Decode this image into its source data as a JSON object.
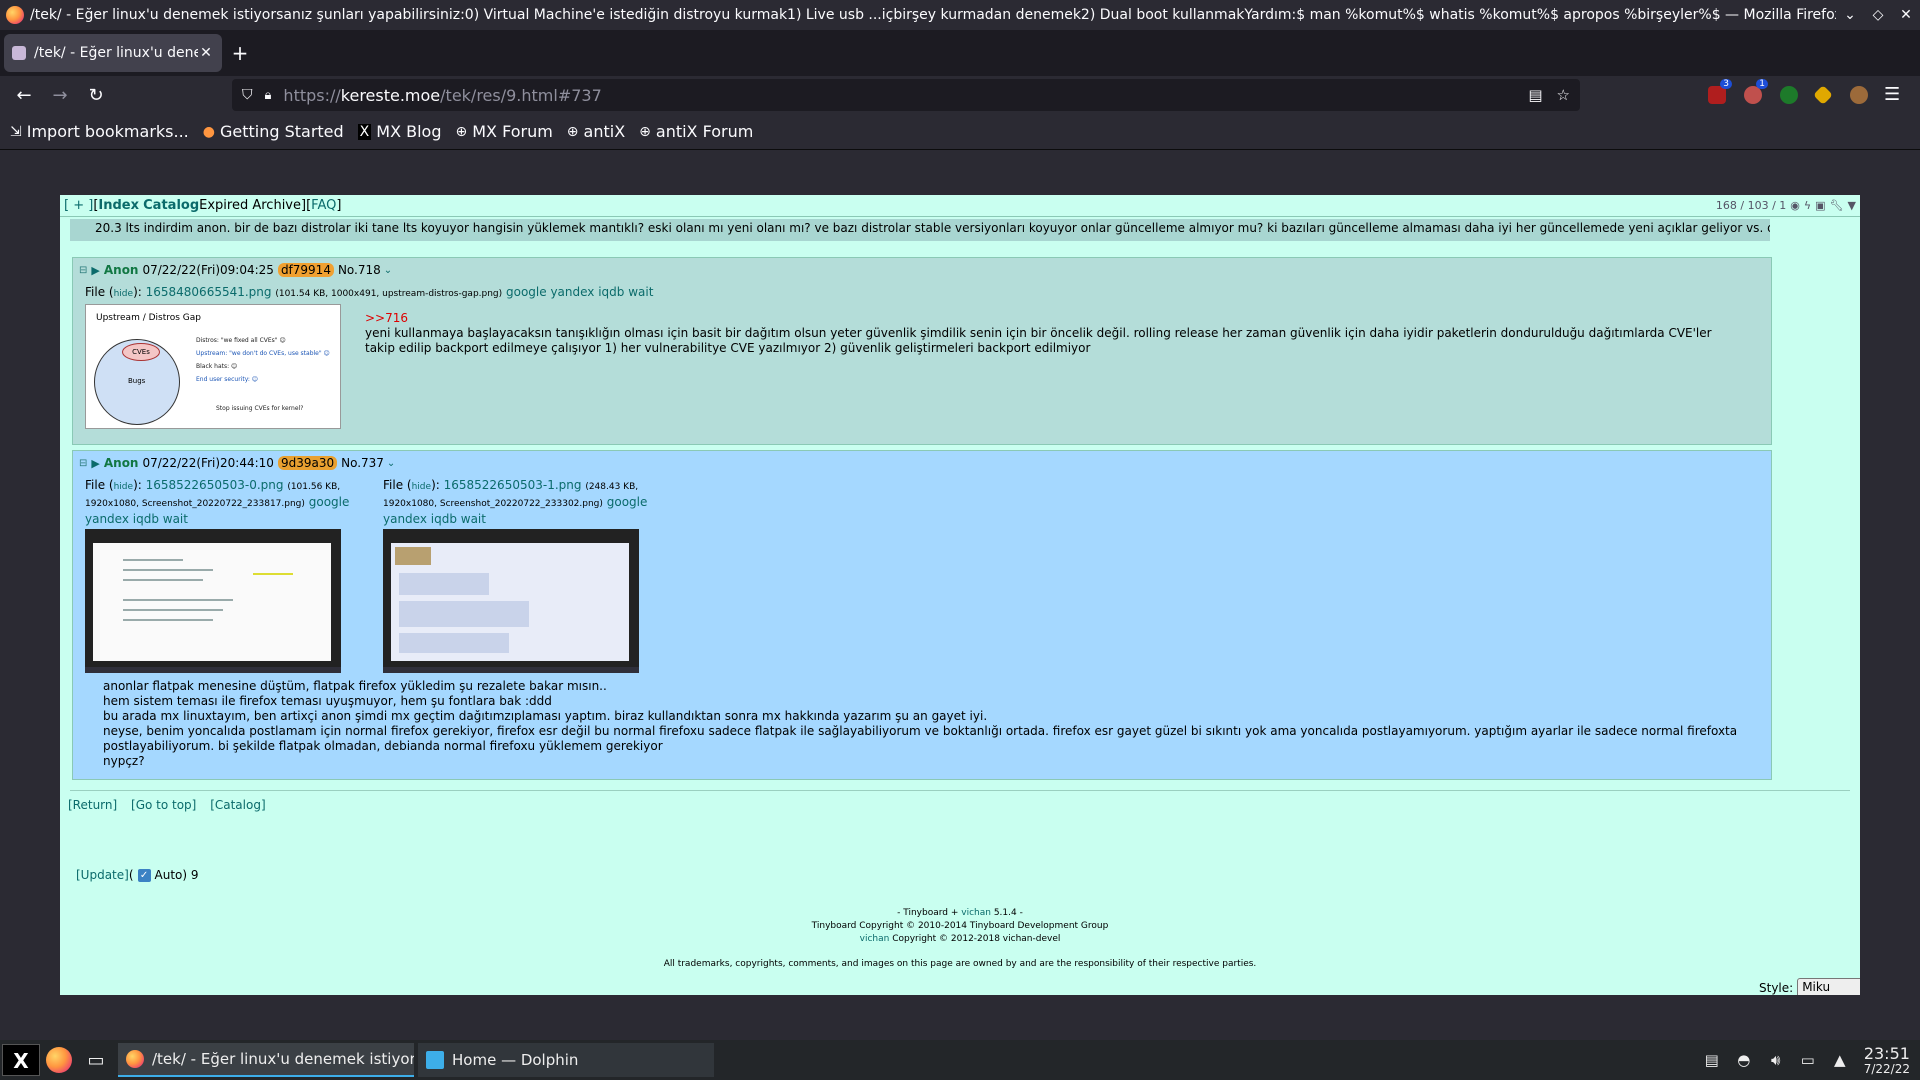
{
  "window": {
    "title": "/tek/ - Eğer linux'u denemek istiyorsanız şunları yapabilirsiniz:0) Virtual Machine'e istediğin distroyu kurmak1) Live usb ...içbirşey kurmadan denemek2) Dual boot kullanmakYardım:$ man %komut%$ whatis %komut%$ apropos %birşeyler%$ — Mozilla Firefox"
  },
  "tabs": [
    {
      "label": "/tek/ - Eğer linux'u dene"
    }
  ],
  "urlbar": {
    "prefix": "https://",
    "domain": "kereste.moe",
    "path": "/tek/res/9.html#737"
  },
  "extensions": [
    {
      "name": "ublock-extension",
      "color": "#b01e1e",
      "badge": "3"
    },
    {
      "name": "tampermonkey-extension",
      "color": "#c0504d",
      "badge": "1"
    },
    {
      "name": "green-extension",
      "color": "#1d7a2a",
      "badge": ""
    },
    {
      "name": "yellow-extension",
      "color": "#e0a800",
      "badge": ""
    },
    {
      "name": "brown-extension",
      "color": "#9c6a3a",
      "badge": ""
    }
  ],
  "bookmarks": [
    {
      "label": "Import bookmarks...",
      "icon": "⇲"
    },
    {
      "label": "Getting Started",
      "icon": "●"
    },
    {
      "label": "MX Blog",
      "icon": "X"
    },
    {
      "label": "MX Forum",
      "icon": "⊕"
    },
    {
      "label": "antiX",
      "icon": "⊕"
    },
    {
      "label": "antiX Forum",
      "icon": "⊕"
    }
  ],
  "boardlist": {
    "plus": "[ + ]",
    "open": " [",
    "index": "Index",
    "catalog": "Catalog",
    "expired": " Expired Archive]",
    "faq_open": " [",
    "faq": "FAQ",
    "faq_close": "]",
    "counts": "168 / 103 / 1"
  },
  "prev_post": {
    "text": "20.3 lts indirdim anon. bir de bazı distrolar iki tane lts koyuyor hangisin yüklemek mantıklı? eski olanı mı yeni olanı mı? ve bazı distrolar stable versiyonları koyuyor onlar güncelleme almıyor mu?  ki bazıları güncelleme almaması daha iyi her güncellemede yeni açıklar geliyor vs. diyorlar."
  },
  "posts": {
    "p718": {
      "name": "Anon",
      "date": "07/22/22(Fri)09:04:25",
      "id": "df79914",
      "id_color": "#f0a030",
      "no": "No.718",
      "file_label": "File",
      "hide": "hide",
      "filename": "1658480665541.png",
      "filemeta": "(101.54 KB, 1000x491, upstream-distros-gap.png)",
      "search": "google yandex iqdb wait",
      "thumb": {
        "title": "Upstream / Distros Gap",
        "cve": "CVEs",
        "bugs": "Bugs",
        "l1": "Distros: \"we fixed all CVEs\" 😊",
        "l2": "Upstream: \"we don't do CVEs, use stable\" 😊",
        "l3": "Black hats: 😊",
        "l4": "End user security: 😊",
        "l5": "Stop issuing CVEs for kernel?"
      },
      "quote": ">>716",
      "body": "yeni kullanmaya başlayacaksın tanışıklığın olması için basit bir dağıtım olsun yeter güvenlik şimdilik senin için bir öncelik değil. rolling release her zaman güvenlik için daha iyidir paketlerin dondurulduğu dağıtımlarda CVE'ler takip edilip backport edilmeye çalışıyor 1) her vulnerabilitye CVE yazılmıyor 2) güvenlik geliştirmeleri backport edilmiyor"
    },
    "p737": {
      "name": "Anon",
      "date": "07/22/22(Fri)20:44:10",
      "id": "9d39a30",
      "id_color": "#e8a030",
      "no": "No.737",
      "files": [
        {
          "file_label": "File",
          "hide": "hide",
          "filename": "1658522650503-0.png",
          "filemeta": "(101.56 KB, 1920x1080, Screenshot_20220722_233817.png)",
          "search": "google yandex iqdb wait"
        },
        {
          "file_label": "File",
          "hide": "hide",
          "filename": "1658522650503-1.png",
          "filemeta": "(248.43 KB, 1920x1080, Screenshot_20220722_233302.png)",
          "search": "google yandex iqdb wait"
        }
      ],
      "body_lines": [
        "anonlar flatpak menesine düştüm, flatpak firefox yükledim şu rezalete bakar mısın..",
        "hem sistem teması ile firefox teması uyuşmuyor, hem şu fontlara bak :ddd",
        "bu arada mx linuxtayım, ben artixçi anon şimdi mx geçtim dağıtımzıplaması yaptım. biraz kullandıktan sonra mx hakkında yazarım şu an gayet iyi.",
        "neyse, benim yoncalıda postlamam için normal firefox gerekiyor, firefox esr değil bu normal firefoxu sadece flatpak ile sağlayabiliyorum ve boktanlığı ortada. firefox esr gayet güzel bi sıkıntı yok ama yoncalıda postlayamıyorum. yaptığım ayarlar ile sadece normal firefoxta postlayabiliyorum. bi şekilde flatpak olmadan, debianda normal firefoxu yüklemem gerekiyor",
        "nypçz?"
      ]
    }
  },
  "bottomnav": {
    "return": "[Return]",
    "top": "[Go to top]",
    "catalog": "[Catalog]"
  },
  "updater": {
    "update": "[Update]",
    "open": " (",
    "auto": " Auto) 9"
  },
  "footer": {
    "line1_a": "- Tinyboard + ",
    "line1_link": "vichan",
    "line1_b": " 5.1.4 -",
    "line2": "Tinyboard Copyright © 2010-2014 Tinyboard Development Group",
    "line3_link": "vichan",
    "line3_b": " Copyright © 2012-2018 vichan-devel",
    "legal": "All trademarks, copyrights, comments, and images on this page are owned by and are the responsibility of their respective parties."
  },
  "style_select": {
    "label": "Style:",
    "value": "Miku"
  },
  "taskbar": {
    "tasks": [
      {
        "label": "/tek/ - Eğer linux'u denemek istiyor..."
      },
      {
        "label": "Home — Dolphin"
      }
    ],
    "time": "23:51",
    "date": "7/22/22"
  }
}
